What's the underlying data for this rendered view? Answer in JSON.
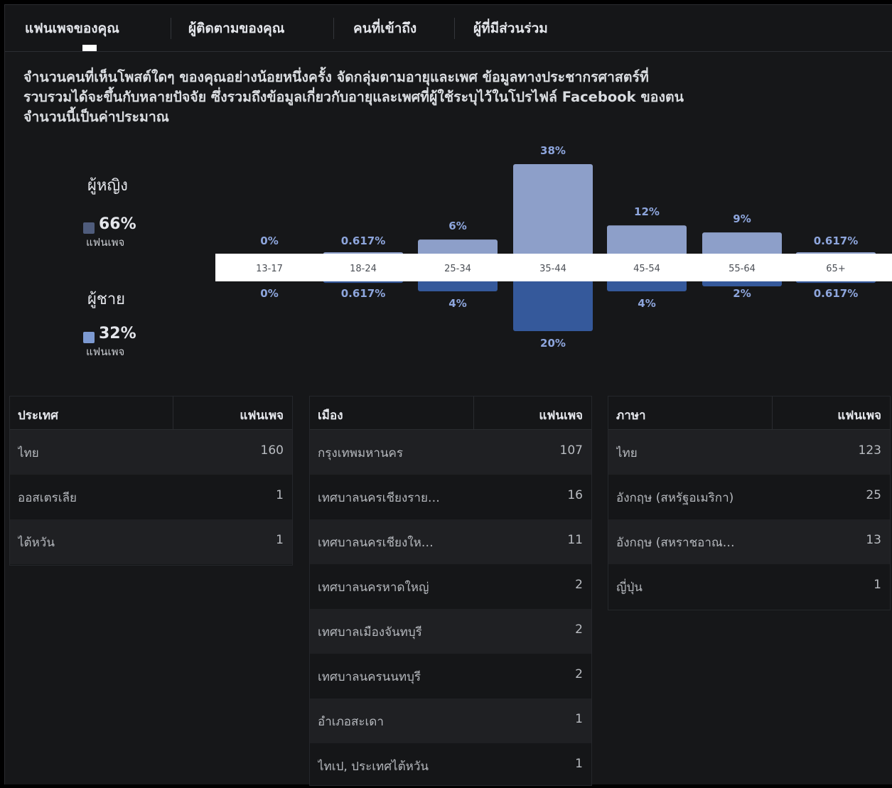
{
  "tabs": [
    {
      "label": "แฟนเพจของคุณ",
      "active": true
    },
    {
      "label": "ผู้ติดตามของคุณ",
      "active": false
    },
    {
      "label": "คนที่เข้าถึง",
      "active": false
    },
    {
      "label": "ผู้ที่มีส่วนร่วม",
      "active": false
    }
  ],
  "description": [
    "จำนวนคนที่เห็นโพสต์ใดๆ ของคุณอย่างน้อยหนึ่งครั้ง จัดกลุ่มตามอายุและเพศ ข้อมูลทางประชากรศาสตร์ที่",
    "รวบรวมได้จะขึ้นกับหลายปัจจัย ซึ่งรวมถึงข้อมูลเกี่ยวกับอายุและเพศที่ผู้ใช้ระบุไว้ในโปรไฟล์ Facebook ของตน",
    "จำนวนนี้เป็นค่าประมาณ"
  ],
  "legend": {
    "female": {
      "title": "ผู้หญิง",
      "pct": "66%",
      "sub": "แฟนเพจ",
      "color": "#4f5c7c"
    },
    "male": {
      "title": "ผู้ชาย",
      "pct": "32%",
      "sub": "แฟนเพจ",
      "color": "#7d9ad2"
    }
  },
  "chart_data": {
    "type": "bar",
    "categories": [
      "13-17",
      "18-24",
      "25-34",
      "35-44",
      "45-54",
      "55-64",
      "65+"
    ],
    "series": [
      {
        "name": "ผู้หญิง",
        "values": [
          0,
          0.617,
          6,
          38,
          12,
          9,
          0.617
        ],
        "labels": [
          "0%",
          "0.617%",
          "6%",
          "38%",
          "12%",
          "9%",
          "0.617%"
        ],
        "color": "#8d9fc9"
      },
      {
        "name": "ผู้ชาย",
        "values": [
          0,
          0.617,
          4,
          20,
          4,
          2,
          0.617
        ],
        "labels": [
          "0%",
          "0.617%",
          "4%",
          "20%",
          "4%",
          "2%",
          "0.617%"
        ],
        "color": "#35599b"
      }
    ],
    "label_color": "#8ea6dd"
  },
  "tables": {
    "country": {
      "header": [
        "ประเทศ",
        "แฟนเพจ"
      ],
      "rows": [
        [
          "ไทย",
          "160"
        ],
        [
          "ออสเตรเลีย",
          "1"
        ],
        [
          "ไต้หวัน",
          "1"
        ]
      ]
    },
    "city": {
      "header": [
        "เมือง",
        "แฟนเพจ"
      ],
      "rows": [
        [
          "กรุงเทพมหานคร",
          "107"
        ],
        [
          "เทศบาลนครเชียงราย…",
          "16"
        ],
        [
          "เทศบาลนครเชียงให…",
          "11"
        ],
        [
          "เทศบาลนครหาดใหญ่",
          "2"
        ],
        [
          "เทศบาลเมืองจันทบุรี",
          "2"
        ],
        [
          "เทศบาลนครนนทบุรี",
          "2"
        ],
        [
          "อำเภอสะเดา",
          "1"
        ],
        [
          "ไทเป, ประเทศไต้หวัน",
          "1"
        ]
      ]
    },
    "language": {
      "header": [
        "ภาษา",
        "แฟนเพจ"
      ],
      "rows": [
        [
          "ไทย",
          "123"
        ],
        [
          "อังกฤษ (สหรัฐอเมริกา)",
          "25"
        ],
        [
          "อังกฤษ (สหราชอาณ…",
          "13"
        ],
        [
          "ญี่ปุ่น",
          "1"
        ]
      ]
    }
  }
}
